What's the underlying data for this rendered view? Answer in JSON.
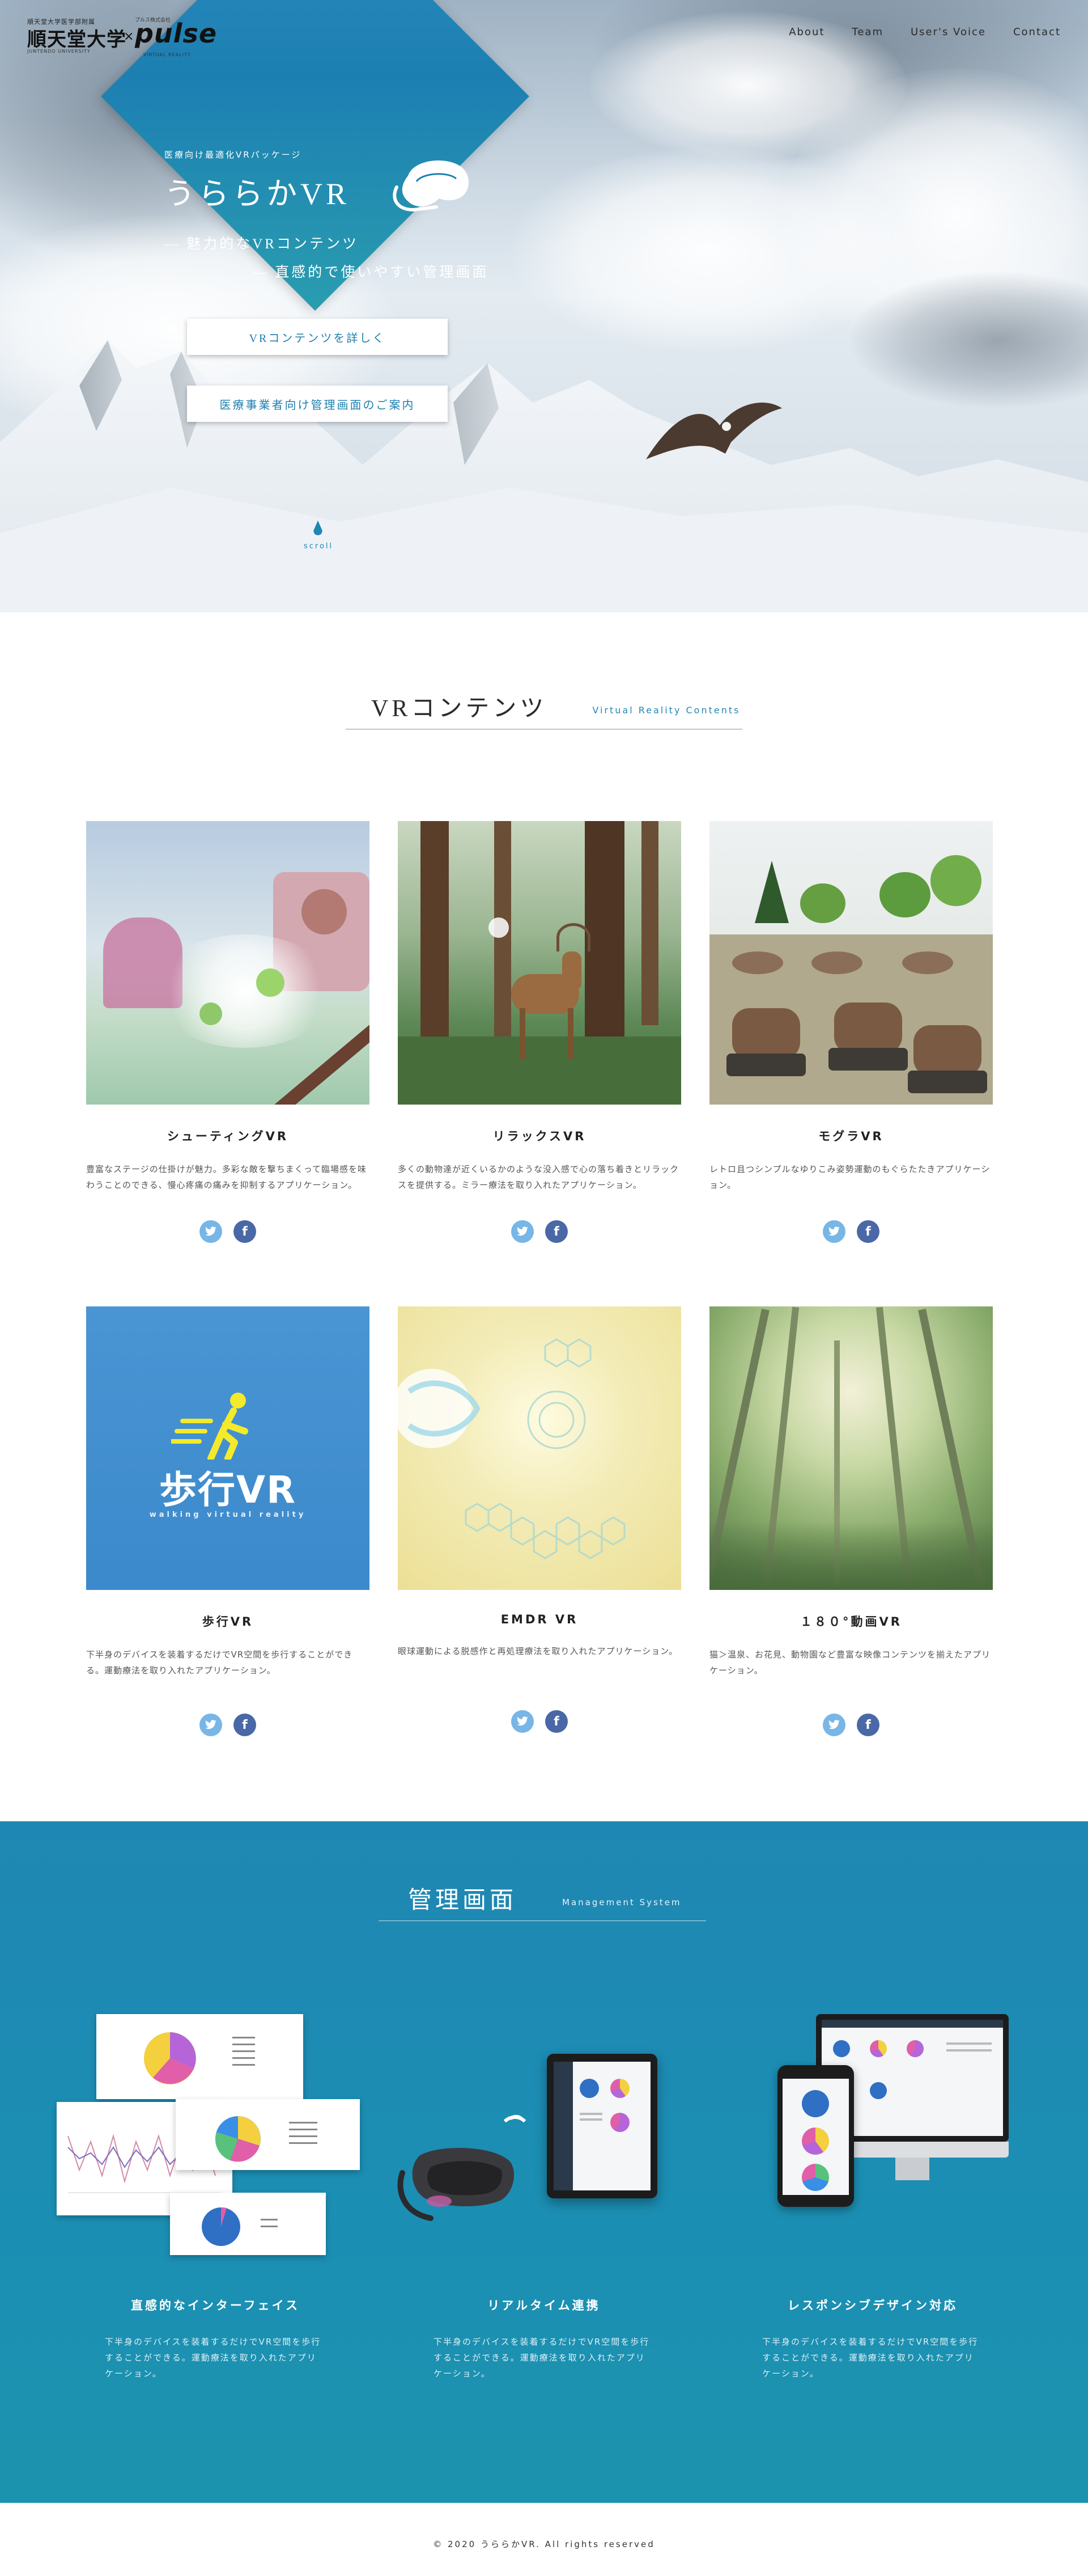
{
  "header": {
    "logo": {
      "small_top": "順天堂大学医学部附属",
      "university": "順天堂大学",
      "small_bottom": "JUNTENDO UNIVERSITY",
      "cross": "×",
      "brand_small": "プルス株式会社",
      "brand": "pulse",
      "brand_tag": "VIRTUAL REALITY"
    },
    "nav": [
      "About",
      "Team",
      "User's Voice",
      "Contact"
    ]
  },
  "hero": {
    "subtitle": "医療向け最適化VRパッケージ",
    "title": "うららかVR",
    "line1": "―  魅力的なVRコンテンツ",
    "line2": "―  直感的で使いやすい管理画面",
    "button_contents": "VRコンテンツを詳しく",
    "button_management": "医療事業者向け管理画面のご案内",
    "scroll_label": "scroll"
  },
  "contents": {
    "heading_jp": "VRコンテンツ",
    "heading_en": "Virtual Reality Contents",
    "cards": [
      {
        "title": "シューティングVR",
        "desc": "豊富なステージの仕掛けが魅力。多彩な敵を撃ちまくって臨場感を味わうことのできる、慢心疼痛の痛みを抑制するアプリケーション。"
      },
      {
        "title": "リラックスVR",
        "desc": "多くの動物達が近くいるかのような没入感で心の落ち着きとリラックスを提供する。ミラー療法を取り入れたアプリケーション。"
      },
      {
        "title": "モグラVR",
        "desc": "レトロ且つシンプルなゆりこみ姿勢運動のもぐらたたきアプリケーション。"
      },
      {
        "title": "歩行VR",
        "desc": "下半身のデバイスを装着するだけでVR空間を歩行することができる。運動療法を取り入れたアプリケーション。"
      },
      {
        "title": "EMDR VR",
        "desc": "眼球運動による脱感作と再処理療法を取り入れたアプリケーション。"
      },
      {
        "title": "１８０°動画VR",
        "desc": "猫＞温泉、お花見、動物園など豊富な映像コンテンツを揃えたアプリケーション。"
      }
    ],
    "walking_logo_main": "歩行VR",
    "walking_logo_sub": "walking virtual reality"
  },
  "management": {
    "heading_jp": "管理画面",
    "heading_en": "Management System",
    "features": [
      {
        "title": "直感的なインターフェイス",
        "desc": "下半身のデバイスを装着するだけでVR空間を歩行することができる。運動療法を取り入れたアプリケーション。"
      },
      {
        "title": "リアルタイム連携",
        "desc": "下半身のデバイスを装着するだけでVR空間を歩行することができる。運動療法を取り入れたアプリケーション。"
      },
      {
        "title": "レスポンシブデザイン対応",
        "desc": "下半身のデバイスを装着するだけでVR空間を歩行することができる。運動療法を取り入れたアプリケーション。"
      }
    ]
  },
  "footer": {
    "copyright": "© 2020 うららかVR. All rights reserved"
  },
  "colors": {
    "accent": "#1e7faf",
    "twitter": "#77b6e6",
    "facebook": "#4a68a6",
    "management_bg": "#1f8cb3"
  }
}
